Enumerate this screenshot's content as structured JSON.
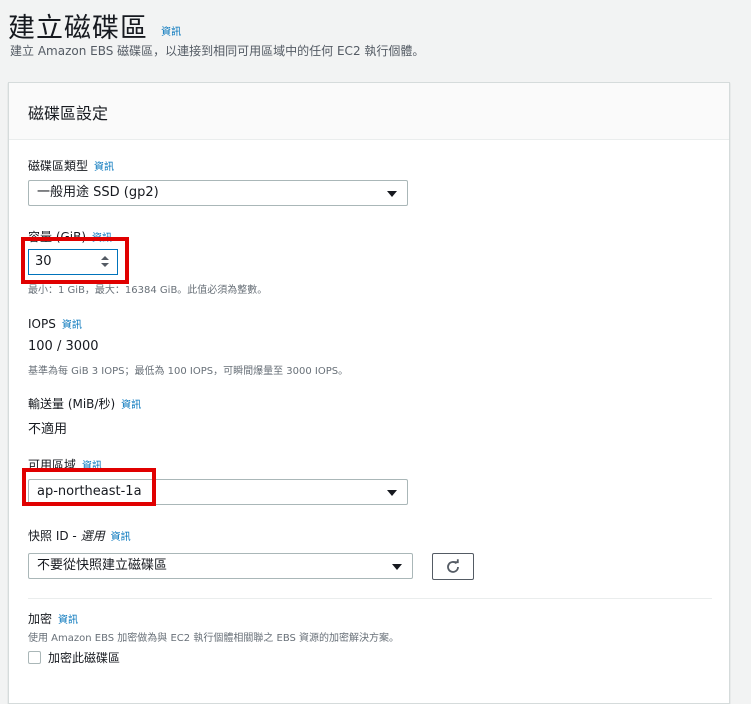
{
  "page": {
    "title": "建立磁碟區",
    "info": "資訊",
    "subtitle": "建立 Amazon EBS 磁碟區，以連接到相同可用區域中的任何 EC2 執行個體。"
  },
  "panel": {
    "title": "磁碟區設定",
    "volume_type": {
      "label": "磁碟區類型",
      "info": "資訊",
      "value": "一般用途 SSD (gp2)"
    },
    "size": {
      "label": "容量 (GiB)",
      "info": "資訊",
      "value": "30",
      "hint": "最小：1 GiB，最大：16384 GiB。此值必須為整數。"
    },
    "iops": {
      "label": "IOPS",
      "info": "資訊",
      "value": "100 / 3000",
      "hint": "基準為每 GiB 3 IOPS；最低為 100 IOPS，可瞬間爆量至 3000 IOPS。"
    },
    "throughput": {
      "label": "輸送量 (MiB/秒)",
      "info": "資訊",
      "value": "不適用"
    },
    "az": {
      "label": "可用區域",
      "info": "資訊",
      "value": "ap-northeast-1a"
    },
    "snapshot": {
      "label": "快照 ID - ",
      "optional": "選用",
      "info": "資訊",
      "value": "不要從快照建立磁碟區"
    },
    "encryption": {
      "label": "加密",
      "info": "資訊",
      "hint": "使用 Amazon EBS 加密做為與 EC2 執行個體相關聯之 EBS 資源的加密解決方案。",
      "checkbox_label": "加密此磁碟區"
    }
  },
  "colors": {
    "link": "#0073bb",
    "highlight": "#e00000"
  }
}
